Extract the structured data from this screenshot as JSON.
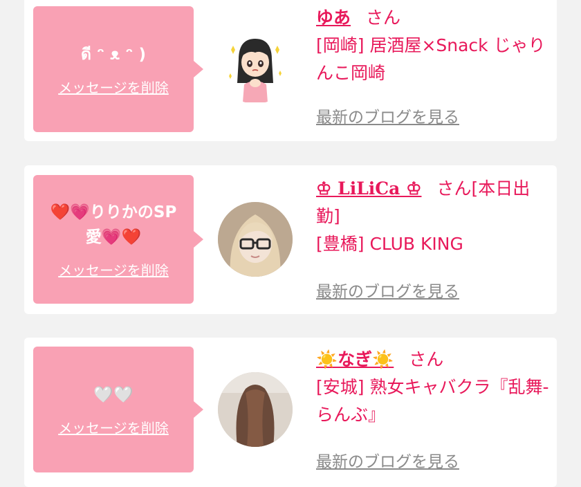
{
  "cards": [
    {
      "message": "ดี ᵔ ᴥ ᵔ )",
      "delete_label": "メッセージを削除",
      "name": "ゆあ",
      "honorific": "さん",
      "shop": "[岡崎] 居酒屋×Snack じゃりんこ岡崎",
      "blog_label": "最新のブログを見る",
      "avatar_kind": "illustration-girl"
    },
    {
      "message": "❤️💗りりかのSP愛💗❤️",
      "delete_label": "メッセージを削除",
      "name": "♔ LiLiCa ♔",
      "honorific": "さん[本日出勤]",
      "shop": "[豊橋] CLUB KING",
      "blog_label": "最新のブログを見る",
      "avatar_kind": "photo-blonde-glasses"
    },
    {
      "message": "🤍🤍",
      "delete_label": "メッセージを削除",
      "name": "☀️なぎ☀️",
      "honorific": "さん",
      "shop": "[安城] 熟女キャバクラ『乱舞-らんぶ』",
      "blog_label": "最新のブログを見る",
      "avatar_kind": "photo-long-hair-back"
    }
  ],
  "colors": {
    "background": "#f2f2f2",
    "card": "#ffffff",
    "bubble": "#f9a1b4",
    "accent": "#e8185a",
    "link_gray": "#8a8a8a"
  }
}
